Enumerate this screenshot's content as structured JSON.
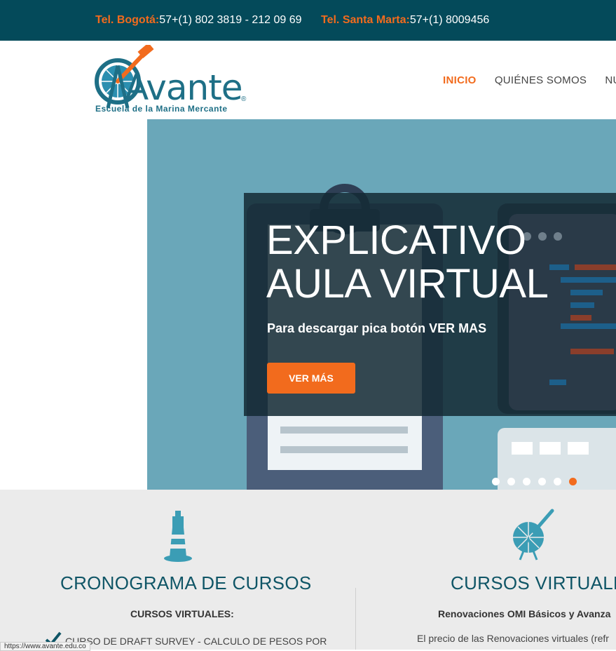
{
  "topbar": {
    "bogota_label": "Tel. Bogotá:",
    "bogota_number": "57+(1) 802 3819 - 212 09 69",
    "santamarta_label": "Tel. Santa Marta:",
    "santamarta_number": "57+(1) 8009456"
  },
  "logo": {
    "name": "Avante",
    "tagline": "Escuela de la Marina Mercante",
    "registered": "®"
  },
  "nav": {
    "items": [
      "INICIO",
      "QUIÉNES SOMOS",
      "NUE"
    ]
  },
  "hero": {
    "title_line1": "EXPLICATIVO",
    "title_line2": "AULA VIRTUAL",
    "subtitle": "Para descargar pica botón VER MAS",
    "button": "VER MÁS"
  },
  "features": {
    "left": {
      "title": "CRONOGRAMA DE CURSOS",
      "subtitle": "CURSOS VIRTUALES:",
      "list_item": "CURSO DE DRAFT SURVEY - CALCULO DE PESOS POR"
    },
    "right": {
      "title": "CURSOS VIRTUALES",
      "subtitle": "Renovaciones OMI Básicos y Avanza",
      "text": "El precio de las Renovaciones virtuales (refr"
    }
  },
  "status_bar": "https://www.avante.edu.co",
  "colors": {
    "topbar": "#044a5a",
    "accent": "#f26b1d",
    "brand": "#1e6f86",
    "hero_bg": "#6aa7b9"
  }
}
